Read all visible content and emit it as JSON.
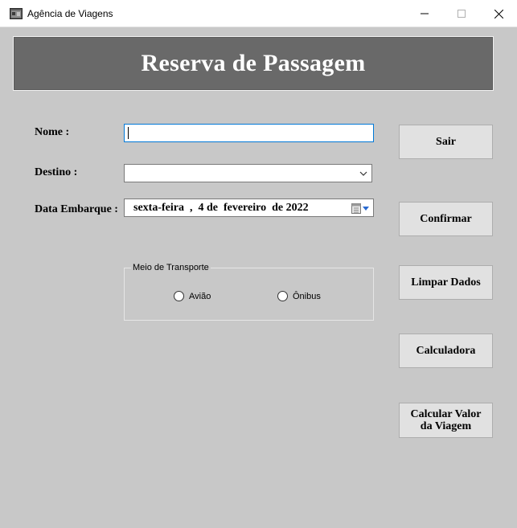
{
  "window": {
    "title": "Agência de Viagens"
  },
  "header": {
    "title": "Reserva de Passagem"
  },
  "form": {
    "nome_label": "Nome :",
    "nome_value": "",
    "destino_label": "Destino :",
    "destino_value": "",
    "data_label": "Data Embarque :",
    "data_value": "sexta-feira  ,  4 de  fevereiro  de 2022"
  },
  "transport": {
    "legend": "Meio de Transporte",
    "options": [
      {
        "label": "Avião",
        "selected": false
      },
      {
        "label": "Ônibus",
        "selected": false
      }
    ]
  },
  "buttons": {
    "sair": "Sair",
    "confirmar": "Confirmar",
    "limpar": "Limpar Dados",
    "calculadora": "Calculadora",
    "calcular_line1": "Calcular Valor",
    "calcular_line2": "da Viagem"
  },
  "icons": {
    "app": "app-window-icon",
    "chevron": "chevron-down-icon",
    "calendar": "calendar-icon"
  },
  "colors": {
    "background": "#c8c8c8",
    "banner": "#696969",
    "focus_border": "#0078d7",
    "button": "#e1e1e1"
  }
}
